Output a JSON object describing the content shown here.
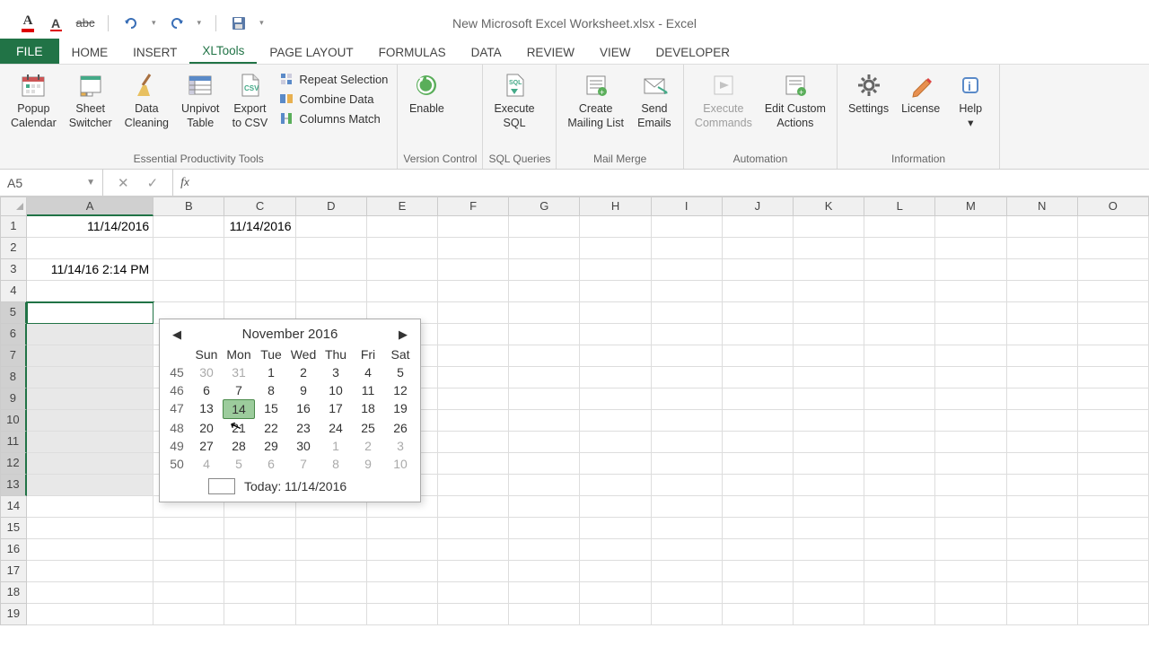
{
  "title": "New Microsoft Excel Worksheet.xlsx - Excel",
  "tabs": [
    "FILE",
    "HOME",
    "INSERT",
    "XLTools",
    "PAGE LAYOUT",
    "FORMULAS",
    "DATA",
    "REVIEW",
    "VIEW",
    "DEVELOPER"
  ],
  "active_tab": "XLTools",
  "ribbon": {
    "groups": [
      {
        "label": "Essential Productivity Tools",
        "buttons": [
          {
            "l1": "Popup",
            "l2": "Calendar",
            "icon": "calendar"
          },
          {
            "l1": "Sheet",
            "l2": "Switcher",
            "icon": "sheets"
          },
          {
            "l1": "Data",
            "l2": "Cleaning",
            "icon": "broom"
          },
          {
            "l1": "Unpivot",
            "l2": "Table",
            "icon": "unpivot"
          },
          {
            "l1": "Export",
            "l2": "to CSV",
            "icon": "csv"
          }
        ],
        "small": [
          {
            "label": "Repeat Selection",
            "icon": "repeat"
          },
          {
            "label": "Combine Data",
            "icon": "combine"
          },
          {
            "label": "Columns Match",
            "icon": "match"
          }
        ]
      },
      {
        "label": "Version Control",
        "buttons": [
          {
            "l1": "Enable",
            "l2": "",
            "icon": "enable"
          }
        ]
      },
      {
        "label": "SQL Queries",
        "buttons": [
          {
            "l1": "Execute",
            "l2": "SQL",
            "icon": "sql"
          }
        ]
      },
      {
        "label": "Mail Merge",
        "buttons": [
          {
            "l1": "Create",
            "l2": "Mailing List",
            "icon": "maillist"
          },
          {
            "l1": "Send",
            "l2": "Emails",
            "icon": "mail"
          }
        ]
      },
      {
        "label": "Automation",
        "buttons": [
          {
            "l1": "Execute",
            "l2": "Commands",
            "icon": "exec",
            "disabled": true
          },
          {
            "l1": "Edit Custom",
            "l2": "Actions",
            "icon": "editact"
          }
        ]
      },
      {
        "label": "Information",
        "buttons": [
          {
            "l1": "Settings",
            "l2": "",
            "icon": "gear"
          },
          {
            "l1": "License",
            "l2": "",
            "icon": "pen"
          },
          {
            "l1": "Help",
            "l2": "▾",
            "icon": "info"
          }
        ]
      }
    ]
  },
  "namebox": "A5",
  "columns": [
    "A",
    "B",
    "C",
    "D",
    "E",
    "F",
    "G",
    "H",
    "I",
    "J",
    "K",
    "L",
    "M",
    "N",
    "O"
  ],
  "cells": {
    "A1": "11/14/2016",
    "C1": "11/14/2016",
    "A3": "11/14/16 2:14 PM"
  },
  "selected_range": {
    "col": "A",
    "rows": [
      5,
      6,
      7,
      8,
      9,
      10,
      11,
      12,
      13
    ]
  },
  "active_cell": "A5",
  "calendar": {
    "month_label": "November 2016",
    "day_headers": [
      "Sun",
      "Mon",
      "Tue",
      "Wed",
      "Thu",
      "Fri",
      "Sat"
    ],
    "weeks": [
      {
        "wn": 45,
        "days": [
          {
            "d": 30,
            "o": true
          },
          {
            "d": 31,
            "o": true
          },
          {
            "d": 1
          },
          {
            "d": 2
          },
          {
            "d": 3
          },
          {
            "d": 4
          },
          {
            "d": 5
          }
        ]
      },
      {
        "wn": 46,
        "days": [
          {
            "d": 6
          },
          {
            "d": 7
          },
          {
            "d": 8
          },
          {
            "d": 9
          },
          {
            "d": 10
          },
          {
            "d": 11
          },
          {
            "d": 12
          }
        ]
      },
      {
        "wn": 47,
        "days": [
          {
            "d": 13
          },
          {
            "d": 14,
            "today": true
          },
          {
            "d": 15
          },
          {
            "d": 16
          },
          {
            "d": 17
          },
          {
            "d": 18
          },
          {
            "d": 19
          }
        ]
      },
      {
        "wn": 48,
        "days": [
          {
            "d": 20
          },
          {
            "d": 21
          },
          {
            "d": 22
          },
          {
            "d": 23
          },
          {
            "d": 24
          },
          {
            "d": 25
          },
          {
            "d": 26
          }
        ]
      },
      {
        "wn": 49,
        "days": [
          {
            "d": 27
          },
          {
            "d": 28
          },
          {
            "d": 29
          },
          {
            "d": 30
          },
          {
            "d": 1,
            "o": true
          },
          {
            "d": 2,
            "o": true
          },
          {
            "d": 3,
            "o": true
          }
        ]
      },
      {
        "wn": 50,
        "days": [
          {
            "d": 4,
            "o": true
          },
          {
            "d": 5,
            "o": true
          },
          {
            "d": 6,
            "o": true
          },
          {
            "d": 7,
            "o": true
          },
          {
            "d": 8,
            "o": true
          },
          {
            "d": 9,
            "o": true
          },
          {
            "d": 10,
            "o": true
          }
        ]
      }
    ],
    "footer": "Today: 11/14/2016"
  }
}
